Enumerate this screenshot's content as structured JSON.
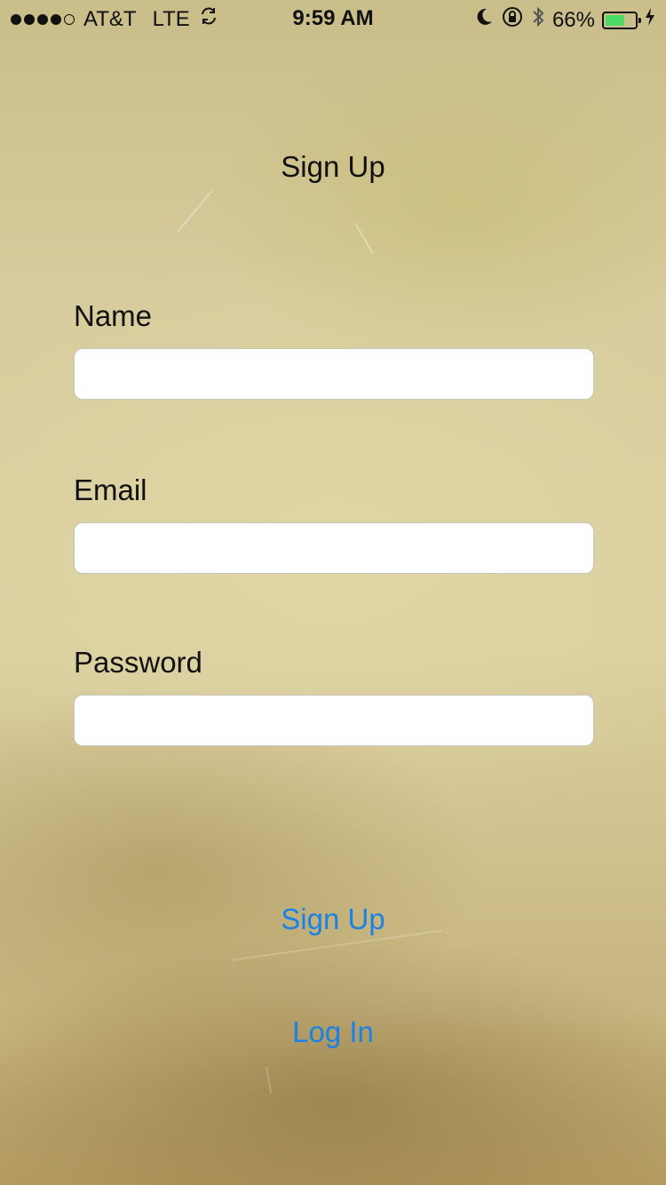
{
  "status_bar": {
    "carrier": "AT&T",
    "network": "LTE",
    "time": "9:59 AM",
    "battery_percent": "66%",
    "battery_level": 0.66,
    "battery_color": "#4cd964",
    "signal_bars_filled": 4,
    "signal_bars_total": 5
  },
  "title": "Sign Up",
  "form": {
    "name_label": "Name",
    "name_value": "",
    "email_label": "Email",
    "email_value": "",
    "password_label": "Password",
    "password_value": ""
  },
  "actions": {
    "sign_up_label": "Sign Up",
    "log_in_label": "Log In"
  },
  "colors": {
    "link": "#1a82e6",
    "background": "#d7cc9d"
  }
}
